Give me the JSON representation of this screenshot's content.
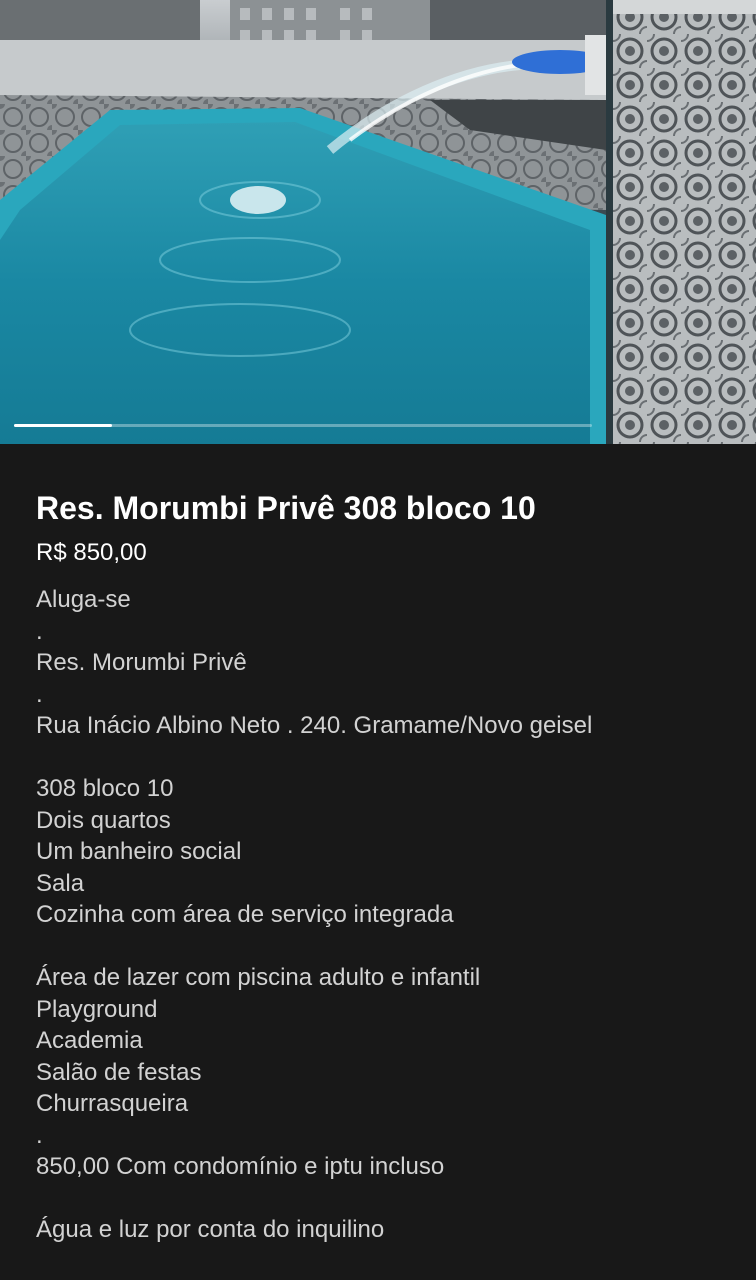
{
  "listing": {
    "title": "Res. Morumbi Privê 308 bloco 10",
    "price": "R$ 850,00",
    "description_lines": [
      "Aluga-se",
      ".",
      "Res. Morumbi Privê",
      ".",
      "Rua Inácio Albino Neto . 240. Gramame/Novo geisel",
      "",
      "308 bloco 10",
      "Dois quartos",
      "Um banheiro social",
      "Sala",
      "Cozinha com área de serviço integrada",
      "",
      "Área de lazer com piscina adulto e infantil",
      "Playground",
      "Academia",
      "Salão de festas",
      "Churrasqueira",
      ".",
      "850,00 Com condomínio e iptu incluso",
      "",
      "Água e luz por conta do inquilino"
    ]
  },
  "gallery": {
    "progress_fraction": 0.17
  },
  "colors": {
    "background": "#181818",
    "text_primary": "#ffffff",
    "text_secondary": "#d2d2d2",
    "pool_water": "#1e8fa8"
  }
}
